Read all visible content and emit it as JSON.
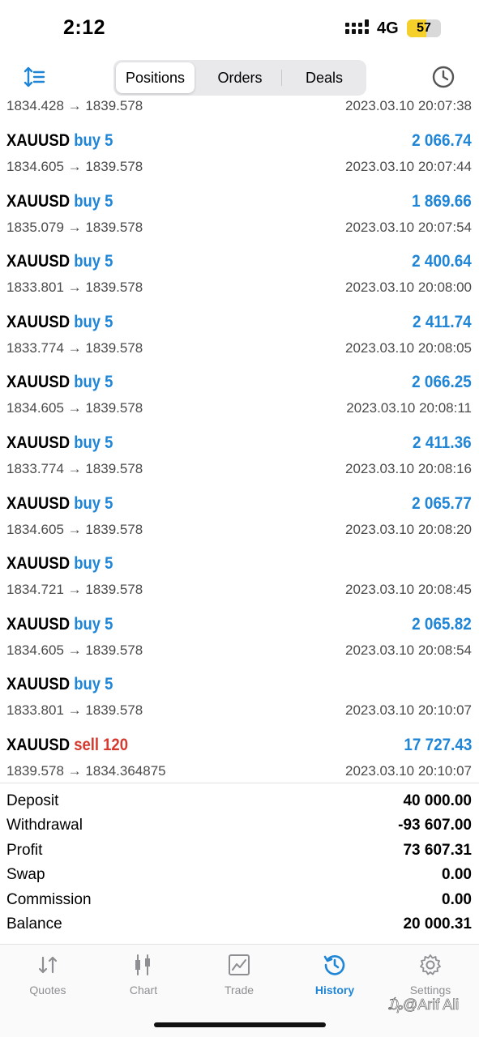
{
  "status_bar": {
    "time": "2:12",
    "network": "4G",
    "battery": "57",
    "battery_level": 0.57
  },
  "toolbar": {
    "tabs": [
      {
        "label": "Positions",
        "active": true
      },
      {
        "label": "Orders",
        "active": false
      },
      {
        "label": "Deals",
        "active": false
      }
    ],
    "sort_icon": "sort-icon",
    "clock_icon": "clock-icon"
  },
  "colors": {
    "accent": "#1f85d6",
    "sell": "#d63a2e",
    "text_secondary": "#4a4a4a"
  },
  "partial_row": {
    "prices": "1834.428 → 1839.578",
    "time": "2023.03.10 20:07:38"
  },
  "deals": [
    {
      "symbol": "XAUUSD",
      "side": "buy 5",
      "prices": "1834.605 → 1839.578",
      "profit": "2 066.74",
      "time": "2023.03.10 20:07:44"
    },
    {
      "symbol": "XAUUSD",
      "side": "buy 5",
      "prices": "1835.079 → 1839.578",
      "profit": "1 869.66",
      "time": "2023.03.10 20:07:54"
    },
    {
      "symbol": "XAUUSD",
      "side": "buy 5",
      "prices": "1833.801 → 1839.578",
      "profit": "2 400.64",
      "time": "2023.03.10 20:08:00"
    },
    {
      "symbol": "XAUUSD",
      "side": "buy 5",
      "prices": "1833.774 → 1839.578",
      "profit": "2 411.74",
      "time": "2023.03.10 20:08:05"
    },
    {
      "symbol": "XAUUSD",
      "side": "buy 5",
      "prices": "1834.605 → 1839.578",
      "profit": "2 066.25",
      "time": "2023.03.10 20:08:11"
    },
    {
      "symbol": "XAUUSD",
      "side": "buy 5",
      "prices": "1833.774 → 1839.578",
      "profit": "2 411.36",
      "time": "2023.03.10 20:08:16"
    },
    {
      "symbol": "XAUUSD",
      "side": "buy 5",
      "prices": "1834.605 → 1839.578",
      "profit": "2 065.77",
      "time": "2023.03.10 20:08:20"
    },
    {
      "symbol": "XAUUSD",
      "side": "buy 5",
      "prices": "1834.721 → 1839.578",
      "profit": "",
      "time": "2023.03.10 20:08:45"
    },
    {
      "symbol": "XAUUSD",
      "side": "buy 5",
      "prices": "1834.605 → 1839.578",
      "profit": "2 065.82",
      "time": "2023.03.10 20:08:54"
    },
    {
      "symbol": "XAUUSD",
      "side": "buy 5",
      "prices": "1833.801 → 1839.578",
      "profit": "",
      "time": "2023.03.10 20:10:07"
    },
    {
      "symbol": "XAUUSD",
      "side": "sell 120",
      "prices": "1839.578 → 1834.364875",
      "profit": "17 727.43",
      "time": "2023.03.10 20:10:07"
    }
  ],
  "summary": [
    {
      "label": "Deposit",
      "value": "40 000.00"
    },
    {
      "label": "Withdrawal",
      "value": "-93 607.00"
    },
    {
      "label": "Profit",
      "value": "73 607.31"
    },
    {
      "label": "Swap",
      "value": "0.00"
    },
    {
      "label": "Commission",
      "value": "0.00"
    },
    {
      "label": "Balance",
      "value": "20 000.31"
    }
  ],
  "tabbar": [
    {
      "label": "Quotes",
      "icon": "quotes-icon",
      "active": false
    },
    {
      "label": "Chart",
      "icon": "chart-icon",
      "active": false
    },
    {
      "label": "Trade",
      "icon": "trade-icon",
      "active": false
    },
    {
      "label": "History",
      "icon": "history-icon",
      "active": true
    },
    {
      "label": "Settings",
      "icon": "settings-icon",
      "active": false
    }
  ],
  "watermark": "₯@Arif Ali"
}
